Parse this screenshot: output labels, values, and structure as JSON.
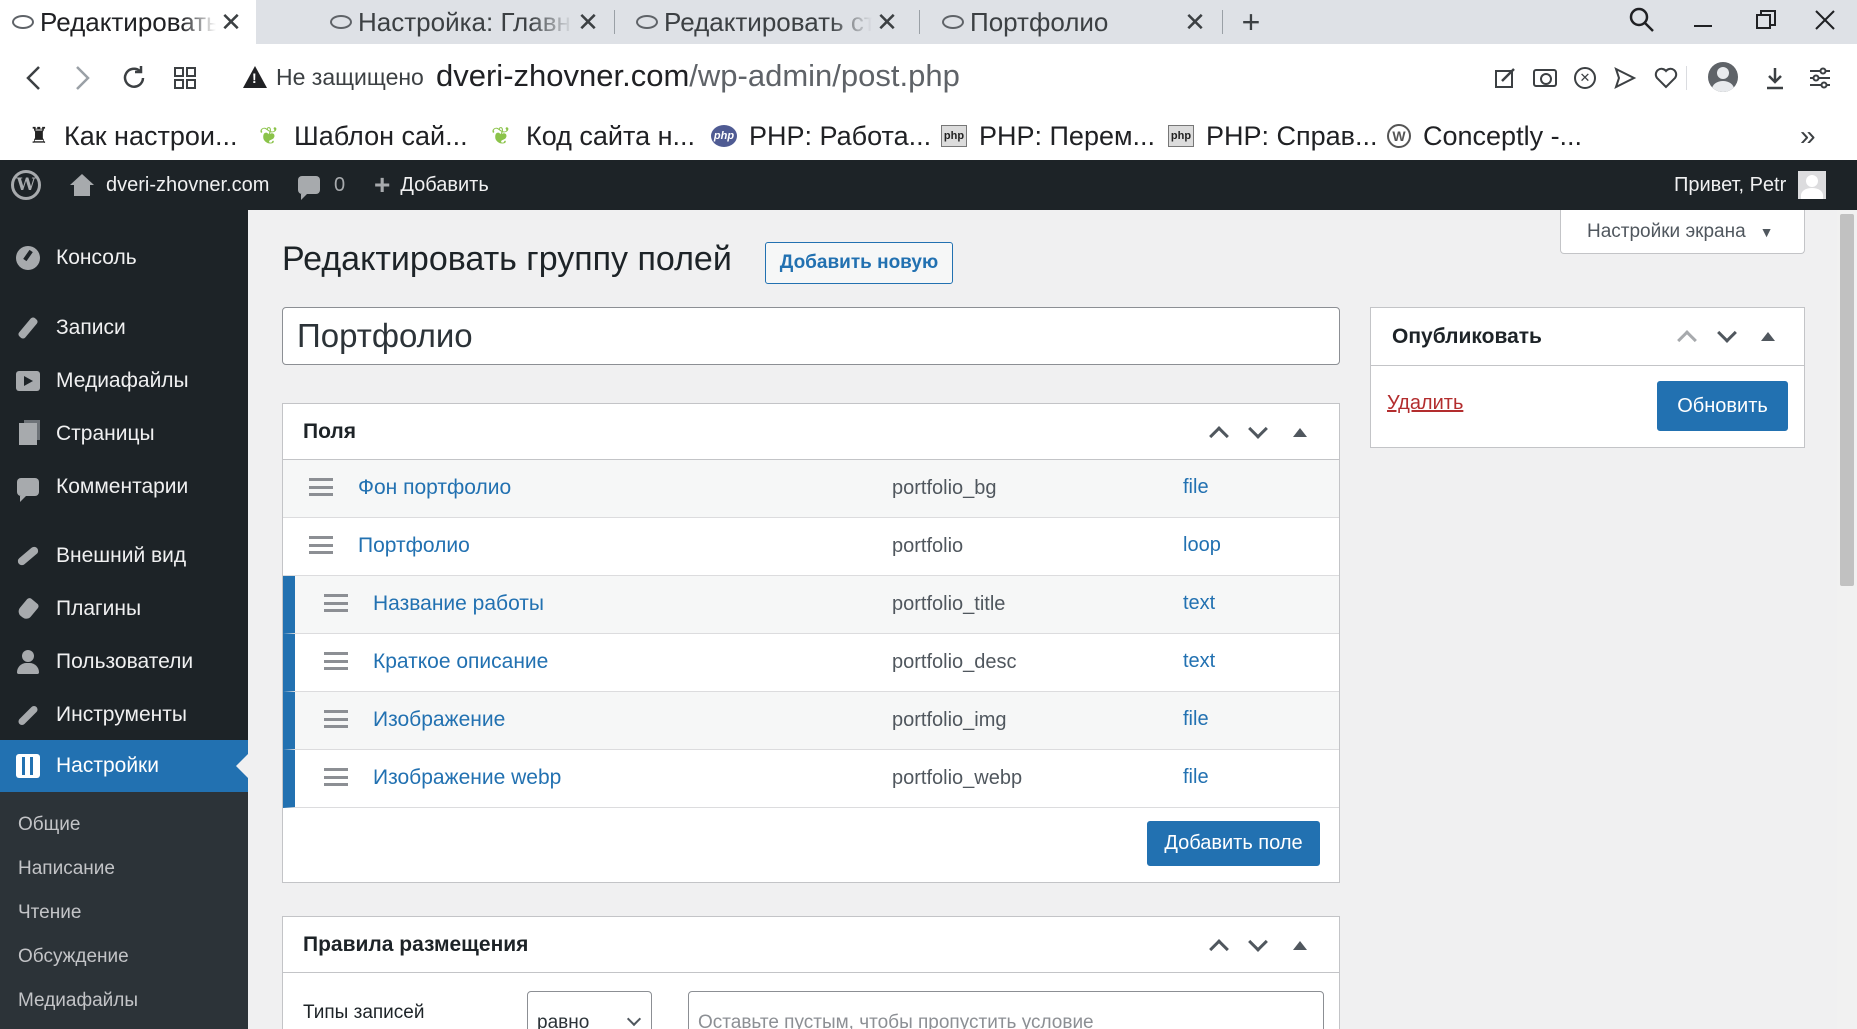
{
  "browser": {
    "tabs": [
      {
        "title": "Редактировать гр",
        "active": true
      },
      {
        "title": "Настройка: Главн",
        "active": false
      },
      {
        "title": "Редактировать ст",
        "active": false
      },
      {
        "title": "Портфолио",
        "active": false
      }
    ],
    "security_label": "Не защищено",
    "url_host": "dveri-zhovner.com",
    "url_path": "/wp-admin/post.php",
    "bookmarks": [
      {
        "label": "Как настрои...",
        "icon": "mug-icon"
      },
      {
        "label": "Шаблон сай...",
        "icon": "leaf-icon"
      },
      {
        "label": "Код сайта н...",
        "icon": "leaf-icon"
      },
      {
        "label": "PHP: Работа...",
        "icon": "php-icon"
      },
      {
        "label": "PHP: Перем...",
        "icon": "php-icon"
      },
      {
        "label": "PHP: Справ...",
        "icon": "php-icon"
      },
      {
        "label": "Conceptly -...",
        "icon": "wordpress-icon"
      }
    ]
  },
  "adminbar": {
    "site_name": "dveri-zhovner.com",
    "comments_count": "0",
    "add_label": "Добавить",
    "greeting": "Привет, Petr"
  },
  "sidebar": {
    "items": [
      {
        "label": "Консоль",
        "icon": "dashboard-icon"
      },
      {
        "label": "Записи",
        "icon": "pin-icon"
      },
      {
        "label": "Медиафайлы",
        "icon": "media-icon"
      },
      {
        "label": "Страницы",
        "icon": "pages-icon"
      },
      {
        "label": "Комментарии",
        "icon": "comments-icon"
      },
      {
        "label": "Внешний вид",
        "icon": "appearance-icon"
      },
      {
        "label": "Плагины",
        "icon": "plugins-icon"
      },
      {
        "label": "Пользователи",
        "icon": "users-icon"
      },
      {
        "label": "Инструменты",
        "icon": "tools-icon"
      },
      {
        "label": "Настройки",
        "icon": "settings-icon",
        "current": true
      }
    ],
    "submenu": [
      "Общие",
      "Написание",
      "Чтение",
      "Обсуждение",
      "Медиафайлы"
    ]
  },
  "main": {
    "screen_options": "Настройки экрана",
    "page_title": "Редактировать группу полей",
    "add_new": "Добавить новую",
    "group_title": "Портфолио",
    "fields_box": {
      "title": "Поля",
      "rows": [
        {
          "label": "Фон портфолио",
          "name": "portfolio_bg",
          "type": "file",
          "child": false
        },
        {
          "label": "Портфолио",
          "name": "portfolio",
          "type": "loop",
          "child": false
        },
        {
          "label": "Название работы",
          "name": "portfolio_title",
          "type": "text",
          "child": true
        },
        {
          "label": "Краткое описание",
          "name": "portfolio_desc",
          "type": "text",
          "child": true
        },
        {
          "label": "Изображение",
          "name": "portfolio_img",
          "type": "file",
          "child": true
        },
        {
          "label": "Изображение webp",
          "name": "portfolio_webp",
          "type": "file",
          "child": true
        }
      ],
      "add_field": "Добавить поле"
    },
    "rules_box": {
      "title": "Правила размещения",
      "rule_label": "Типы записей",
      "operator": "равно",
      "value_placeholder": "Оставьте пустым, чтобы пропустить условие"
    },
    "publish_box": {
      "title": "Опубликовать",
      "delete_label": "Удалить",
      "update_label": "Обновить"
    }
  },
  "colors": {
    "accent": "#2271b1",
    "admin_dark": "#1d2327",
    "delete_red": "#b32d2e"
  }
}
